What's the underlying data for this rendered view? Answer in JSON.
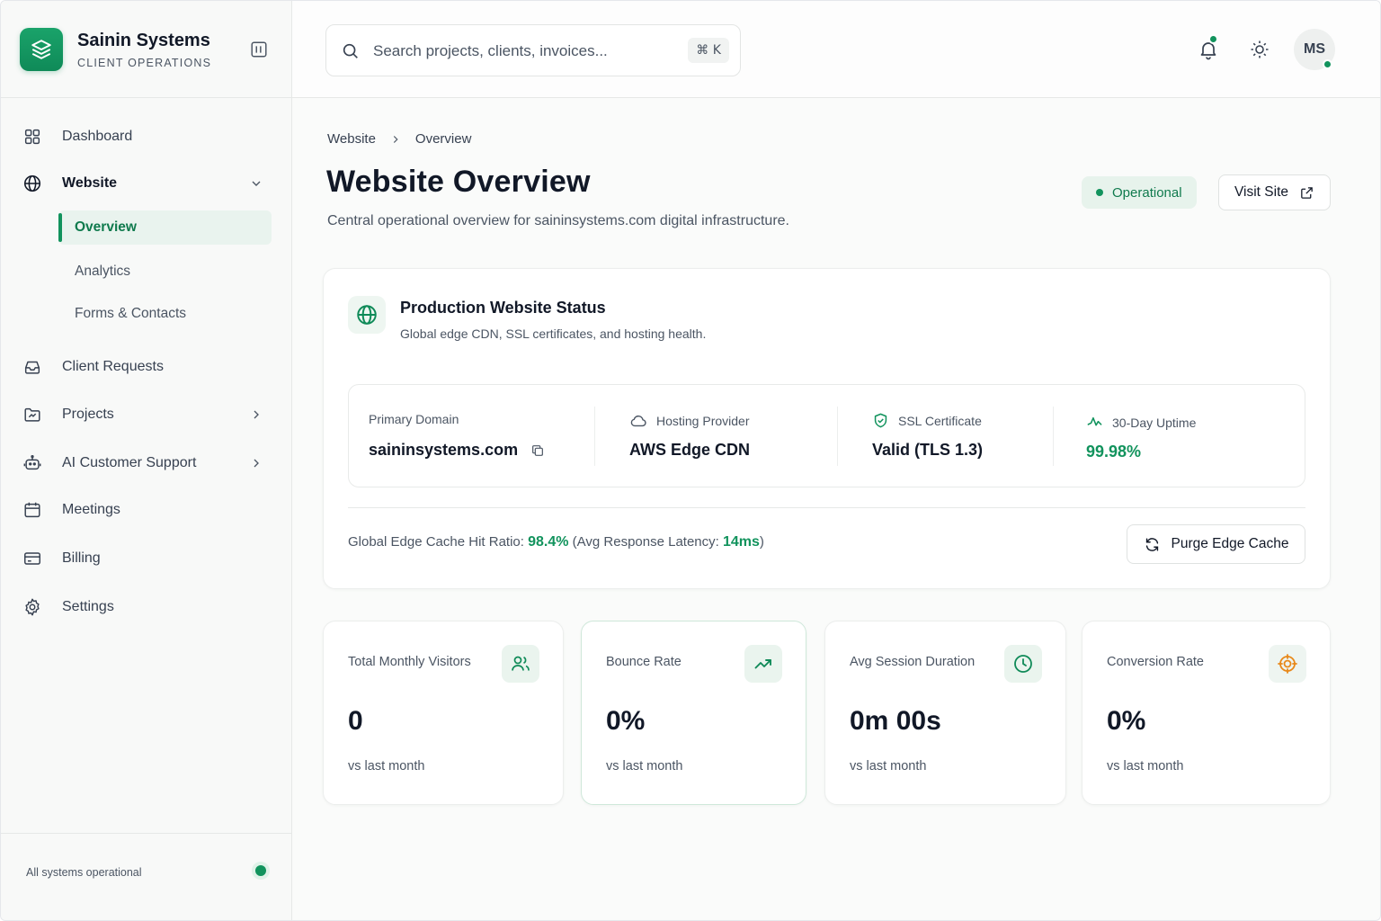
{
  "brand": {
    "name": "Sainin Systems",
    "subtitle": "CLIENT OPERATIONS"
  },
  "sidebar": {
    "items": [
      {
        "label": "Dashboard",
        "icon": "grid-icon"
      },
      {
        "label": "Website",
        "icon": "globe-icon",
        "expanded": true
      },
      {
        "label": "Client Requests",
        "icon": "inbox-icon"
      },
      {
        "label": "Projects",
        "icon": "folder-icon"
      },
      {
        "label": "AI Customer Support",
        "icon": "bot-icon"
      },
      {
        "label": "Meetings",
        "icon": "calendar-icon"
      },
      {
        "label": "Billing",
        "icon": "credit-card-icon"
      },
      {
        "label": "Settings",
        "icon": "gear-icon"
      }
    ],
    "website_sub": [
      {
        "label": "Overview",
        "active": true
      },
      {
        "label": "Analytics"
      },
      {
        "label": "Forms & Contacts"
      }
    ],
    "footer": {
      "status": "All systems operational"
    }
  },
  "search": {
    "placeholder": "Search projects, clients, invoices...",
    "shortcut": "⌘ K"
  },
  "user": {
    "initials": "MS"
  },
  "breadcrumb": {
    "parent": "Website",
    "current": "Overview"
  },
  "page": {
    "title": "Website Overview",
    "description": "Central operational overview for saininsystems.com digital infrastructure.",
    "status": "Operational",
    "visit_label": "Visit Site"
  },
  "status_card": {
    "title": "Production Website Status",
    "subtitle": "Global edge CDN, SSL certificates, and hosting health.",
    "metrics": [
      {
        "label": "Primary Domain",
        "value": "saininsystems.com"
      },
      {
        "label": "Hosting Provider",
        "value": "AWS Edge CDN"
      },
      {
        "label": "SSL Certificate",
        "value": "Valid (TLS 1.3)"
      },
      {
        "label": "30-Day Uptime",
        "value": "99.98%"
      }
    ],
    "cache": {
      "prefix": "Global Edge Cache Hit Ratio: ",
      "ratio": "98.4%",
      "mid": " (Avg Response Latency: ",
      "latency": "14ms",
      "suffix": ")"
    },
    "purge_label": "Purge Edge Cache"
  },
  "stats": [
    {
      "label": "Total Monthly Visitors",
      "value": "0",
      "foot": "vs last month",
      "icon": "users-icon"
    },
    {
      "label": "Bounce Rate",
      "value": "0%",
      "foot": "vs last month",
      "icon": "trending-up-icon"
    },
    {
      "label": "Avg Session Duration",
      "value": "0m 00s",
      "foot": "vs last month",
      "icon": "clock-icon"
    },
    {
      "label": "Conversion Rate",
      "value": "0%",
      "foot": "vs last month",
      "icon": "target-icon"
    }
  ],
  "colors": {
    "accent": "#12935d",
    "accent_bg": "#e7f3ec",
    "target_icon": "#e8891b"
  }
}
